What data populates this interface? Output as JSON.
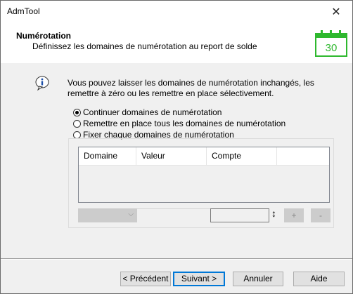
{
  "window": {
    "title": "AdmTool",
    "close_glyph": "✕"
  },
  "header": {
    "title": "Numérotation",
    "subtitle": "Définissez les domaines de numérotation au report de solde",
    "calendar_number": "30",
    "calendar_color": "#2eb82e"
  },
  "info": {
    "icon": "info-icon",
    "text": "Vous pouvez laisser les domaines de numérotation inchangés, les remettre à zéro ou les remettre en place sélectivement."
  },
  "options": [
    {
      "label": "Continuer domaines de numérotation",
      "selected": true
    },
    {
      "label": "Remettre en place tous les domaines de numérotation",
      "selected": false
    },
    {
      "label": "Fixer chaque domaines de numérotation",
      "selected": false
    }
  ],
  "table": {
    "columns": [
      "Domaine",
      "Valeur",
      "Compte"
    ]
  },
  "editor": {
    "add_label": "+",
    "remove_label": "-",
    "combo_value": ""
  },
  "buttons": {
    "back": "< Précédent",
    "next": "Suivant >",
    "cancel": "Annuler",
    "help": "Aide"
  }
}
